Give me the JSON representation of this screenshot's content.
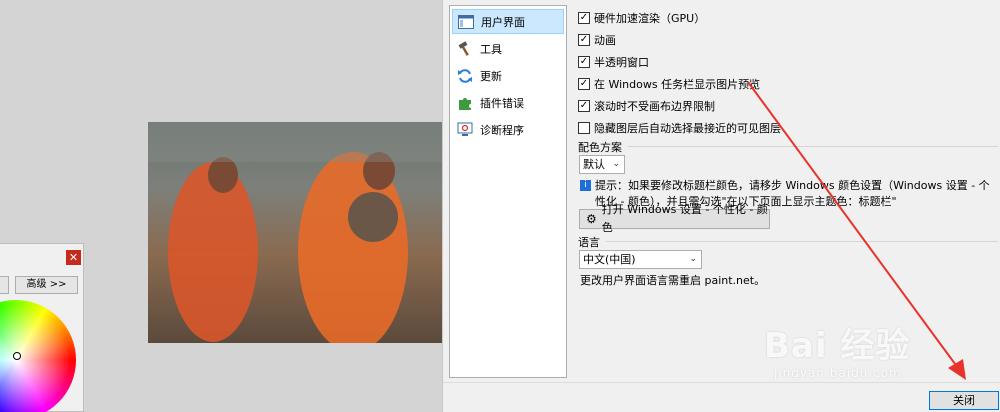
{
  "color_panel": {
    "advanced_button": "高级 >>",
    "close_glyph": "✕"
  },
  "settings": {
    "nav_items": [
      {
        "label": "用户界面",
        "icon": "window-icon",
        "selected": true
      },
      {
        "label": "工具",
        "icon": "hammer-icon",
        "selected": false
      },
      {
        "label": "更新",
        "icon": "refresh-icon",
        "selected": false
      },
      {
        "label": "插件错误",
        "icon": "puzzle-icon",
        "selected": false
      },
      {
        "label": "诊断程序",
        "icon": "diagnostics-icon",
        "selected": false
      }
    ],
    "options": [
      {
        "label": "硬件加速渲染（GPU）",
        "checked": true
      },
      {
        "label": "动画",
        "checked": true
      },
      {
        "label": "半透明窗口",
        "checked": true
      },
      {
        "label": "在 Windows 任务栏显示图片预览",
        "checked": true
      },
      {
        "label": "滚动时不受画布边界限制",
        "checked": true
      },
      {
        "label": "隐藏图层后自动选择最接近的可见图层",
        "checked": false
      }
    ],
    "color_scheme": {
      "title": "配色方案",
      "selected": "默认"
    },
    "tip": {
      "icon": "i",
      "text": "提示：如果要修改标题栏颜色，请移步 Windows 颜色设置（Windows 设置 - 个性化 - 颜色），并且需勾选\"在以下页面上显示主题色：标题栏\""
    },
    "open_windows_button": "打开 Windows 设置 - 个性化 - 颜色",
    "language": {
      "title": "语言",
      "selected": "中文(中国)",
      "restart_note": "更改用户界面语言需重启 paint.net。"
    },
    "close_button": "关闭"
  },
  "watermark": {
    "main": "Bai 经验",
    "sub": "jingyan.baidu.com"
  },
  "colors": {
    "selected_bg": "#cce8ff",
    "arrow": "#e8322c",
    "close_red": "#c42b1c"
  }
}
